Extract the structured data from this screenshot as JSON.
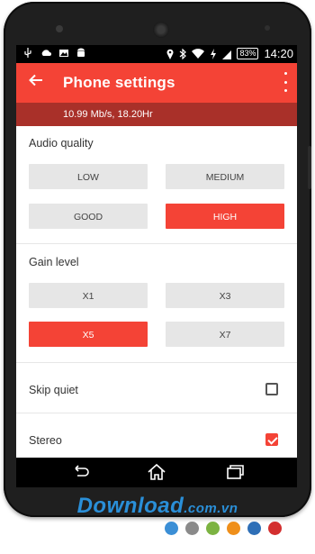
{
  "statusbar": {
    "battery": "83%",
    "time": "14:20"
  },
  "appbar": {
    "title": "Phone settings"
  },
  "subheader": {
    "text": "10.99 Mb/s, 18.20Hr"
  },
  "audio_quality": {
    "label": "Audio quality",
    "options": [
      "LOW",
      "MEDIUM",
      "GOOD",
      "HIGH"
    ],
    "selected": "HIGH"
  },
  "gain_level": {
    "label": "Gain level",
    "options": [
      "X1",
      "X3",
      "X5",
      "X7"
    ],
    "selected": "X5"
  },
  "skip_quiet": {
    "label": "Skip quiet",
    "checked": false
  },
  "stereo": {
    "label": "Stereo",
    "checked": true
  },
  "watermark": {
    "brand": "Download",
    "domain": ".com.vn"
  },
  "colors": {
    "accent": "#f44336",
    "subheader": "#a93029",
    "dots": [
      "#3b8fd6",
      "#8a8a8a",
      "#7cb342",
      "#ef8f1a",
      "#2e6fb7",
      "#d32f2f"
    ]
  }
}
